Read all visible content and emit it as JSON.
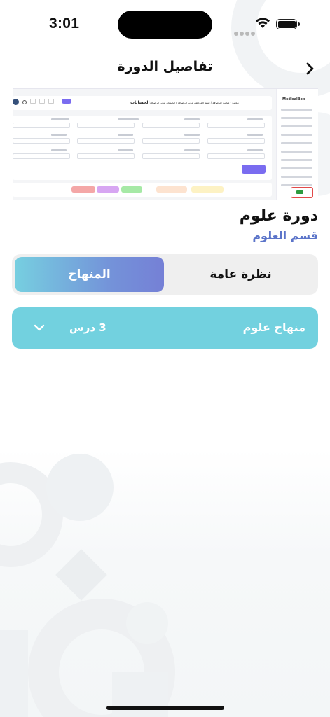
{
  "status_bar": {
    "time": "3:01"
  },
  "header": {
    "title": "تفاصيل الدورة",
    "back_icon": "chevron-right-icon"
  },
  "preview": {
    "page_title": "الحسابات",
    "breadcrumb": "مكتب - مكتب الرصافة / اسم الموظف مدير الرصافة / الصفحة مدير الرصافة",
    "sidebar_brand": "MedicalBox"
  },
  "course": {
    "title": "دورة علوم",
    "department": "قسم العلوم"
  },
  "tabs": {
    "overview": "نظرة عامة",
    "curriculum": "المنهاج",
    "active": "curriculum"
  },
  "curriculum": {
    "name": "منهاج علوم",
    "lessons": "3 درس",
    "expand_icon": "chevron-down-icon"
  },
  "colors": {
    "accent_blue": "#5b74c9",
    "curriculum_bg": "#72d1df",
    "tab_gradient_start": "#76cfe0",
    "tab_gradient_end": "#7580d6"
  }
}
